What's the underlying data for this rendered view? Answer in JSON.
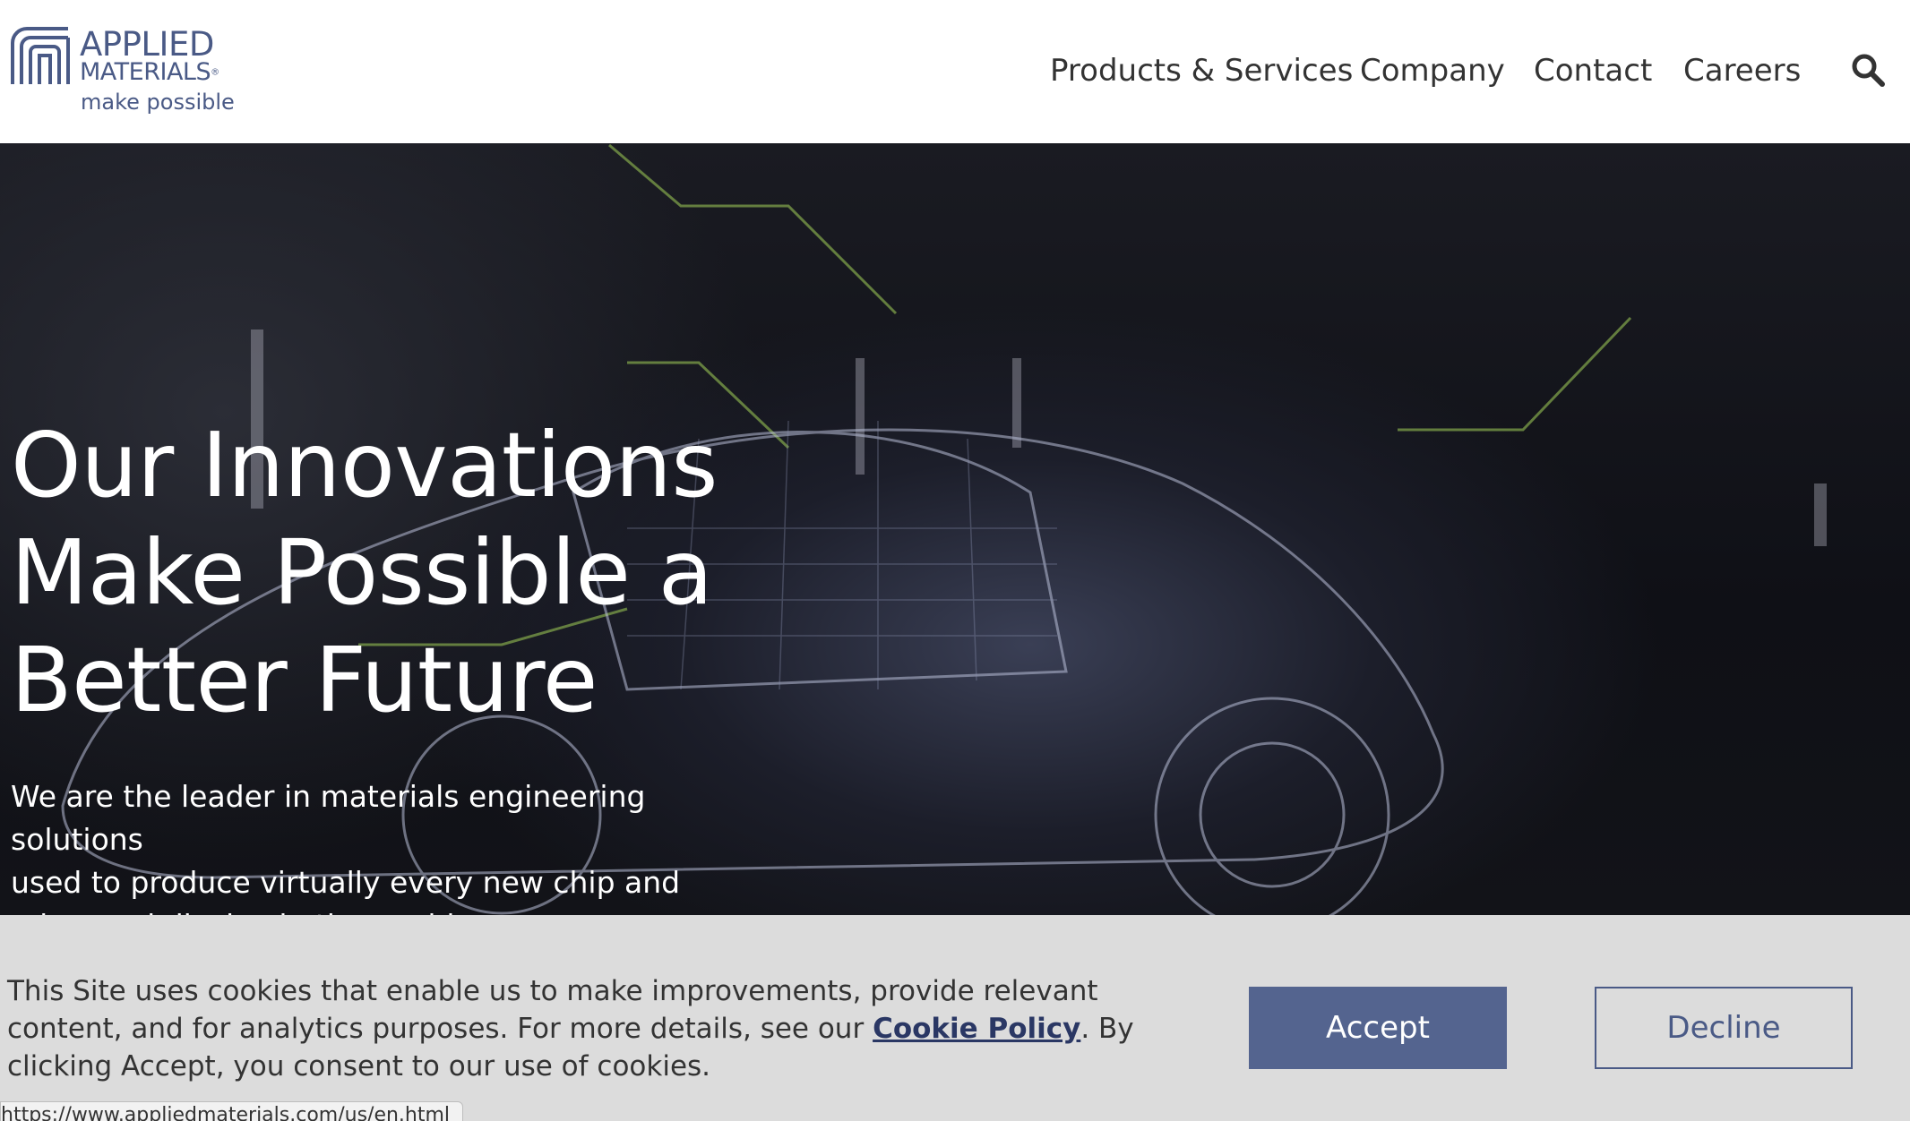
{
  "header": {
    "logo": {
      "line1": "APPLIED",
      "line2": "MATERIALS",
      "registered": "®",
      "tagline": "make possible"
    },
    "nav": {
      "items": [
        {
          "label": "Products & Services"
        },
        {
          "label": "Company"
        },
        {
          "label": "Contact"
        },
        {
          "label": "Careers"
        }
      ],
      "search_icon": "search-icon"
    }
  },
  "hero": {
    "title_lines": [
      "Our Innovations",
      "Make Possible a",
      "Better Future"
    ],
    "subtitle_lines": [
      "We are the leader in materials engineering solutions",
      "used to produce virtually every new chip and",
      "advanced display in the world."
    ]
  },
  "cookie_banner": {
    "text_before_link": "This Site uses cookies that enable us to make improvements, provide relevant content, and for analytics purposes. For more details, see our ",
    "link_label": "Cookie Policy",
    "text_after_link": ". By clicking Accept, you consent to our use of cookies.",
    "accept_label": "Accept",
    "decline_label": "Decline"
  },
  "status_bar": {
    "url": "https://www.appliedmaterials.com/us/en.html"
  },
  "colors": {
    "brand": "#4a5a86",
    "accept_button": "#54648f",
    "cookie_background": "#dcdcdc",
    "nav_text": "#333333"
  }
}
